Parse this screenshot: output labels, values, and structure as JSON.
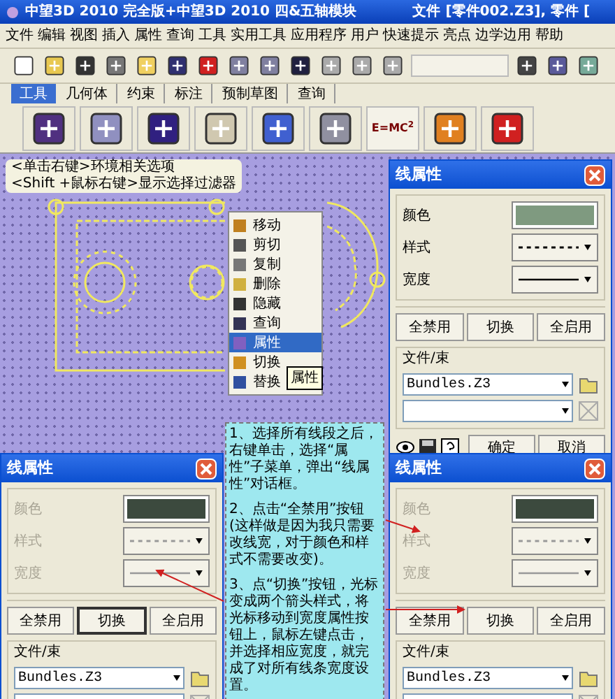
{
  "window": {
    "title": "中望3D 2010 完全版+中望3D 2010 四&五轴模块",
    "file_info": "文件 [零件002.Z3],  零件 ["
  },
  "menu": [
    "文件",
    "编辑",
    "视图",
    "插入",
    "属性",
    "查询",
    "工具",
    "实用工具",
    "应用程序",
    "用户",
    "快速提示",
    "亮点",
    "边学边用",
    "帮助"
  ],
  "tabs": [
    {
      "label": "工具",
      "selected": true
    },
    {
      "label": "几何体",
      "selected": false
    },
    {
      "label": "约束",
      "selected": false
    },
    {
      "label": "标注",
      "selected": false
    },
    {
      "label": "预制草图",
      "selected": false
    },
    {
      "label": "查询",
      "selected": false
    }
  ],
  "ribbon_formula": "E=MC",
  "ribbon_formula_sup": "2",
  "hint": [
    "<单击右键>环境相关选项",
    "<Shift +鼠标右键>显示选择过滤器"
  ],
  "context_menu": {
    "items": [
      {
        "label": "移动",
        "selected": false
      },
      {
        "label": "剪切",
        "selected": false
      },
      {
        "label": "复制",
        "selected": false
      },
      {
        "label": "删除",
        "selected": false
      },
      {
        "label": "隐藏",
        "selected": false
      },
      {
        "label": "查询",
        "selected": false
      },
      {
        "label": "属性",
        "selected": true
      },
      {
        "label": "切换",
        "selected": false
      },
      {
        "label": "替换",
        "selected": false
      }
    ],
    "tooltip": "属性"
  },
  "notes": [
    "1、选择所有线段之后，右键单击，选择“属性”子菜单，弹出“线属性”对话框。",
    "2、点击“全禁用”按钮(这样做是因为我只需要改线宽，对于颜色和样式不需要改变)。",
    "3、点“切换”按钮，光标变成两个箭头样式，将光标移动到宽度属性按钮上，鼠标左键点击，并选择相应宽度，就完成了对所有线条宽度设置。"
  ],
  "dialogs": [
    {
      "title": "线属性",
      "disabled": false,
      "labels": [
        "颜色",
        "样式",
        "宽度"
      ],
      "color": "#7f9a80",
      "buttons": [
        {
          "label": "全禁用",
          "pressed": false
        },
        {
          "label": "切换",
          "pressed": false
        },
        {
          "label": "全启用",
          "pressed": false
        }
      ],
      "group": "文件/束",
      "file": "Bundles.Z3",
      "actions": [
        "确定",
        "取消"
      ]
    },
    {
      "title": "线属性",
      "disabled": true,
      "labels": [
        "颜色",
        "样式",
        "宽度"
      ],
      "color": "#3c4a3e",
      "buttons": [
        {
          "label": "全禁用",
          "pressed": false
        },
        {
          "label": "切换",
          "pressed": true
        },
        {
          "label": "全启用",
          "pressed": false
        }
      ],
      "group": "文件/束",
      "file": "Bundles.Z3"
    },
    {
      "title": "线属性",
      "disabled": true,
      "labels": [
        "颜色",
        "样式",
        "宽度"
      ],
      "color": "#3c4a3e",
      "buttons": [
        {
          "label": "全禁用",
          "pressed": false
        },
        {
          "label": "切换",
          "pressed": false
        },
        {
          "label": "全启用",
          "pressed": false
        }
      ],
      "group": "文件/束",
      "file": "Bundles.Z3"
    }
  ]
}
